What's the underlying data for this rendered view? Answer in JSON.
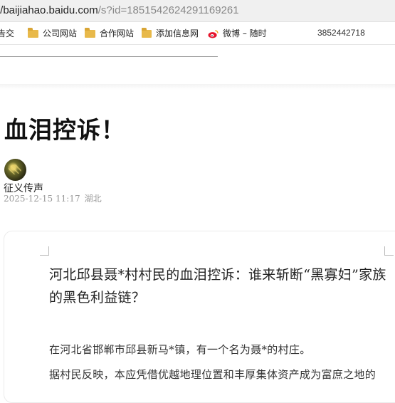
{
  "browser": {
    "url_host": "//baijiahao.baidu.com",
    "url_path": "/s?id=1851542624291169261",
    "bookmarks": [
      {
        "label": "告交",
        "icon": "none"
      },
      {
        "label": "公司网站",
        "icon": "folder-icon"
      },
      {
        "label": "合作网站",
        "icon": "folder-icon"
      },
      {
        "label": "添加信息网",
        "icon": "folder-icon"
      },
      {
        "label": "微博 – 随时",
        "icon": "weibo-icon"
      }
    ],
    "bookmark_extra": "3852442718"
  },
  "article": {
    "title": "血泪控诉！",
    "author": "征义传声",
    "date": "2025-12-15 11:17",
    "location": "湖北",
    "heading": "河北邱县聂*村村民的血泪控诉：谁来斩断“黑寡妇”家族的黑色利益链？",
    "paragraphs": [
      "在河北省邯郸市邱县新马*镇，有一个名为聂*的村庄。",
      "据村民反映，本应凭借优越地理位置和丰厚集体资产成为富庶之地的"
    ]
  },
  "colors": {
    "folder": "#e8b94a",
    "weibo_red": "#e6162d",
    "meta_gray": "#999999"
  }
}
